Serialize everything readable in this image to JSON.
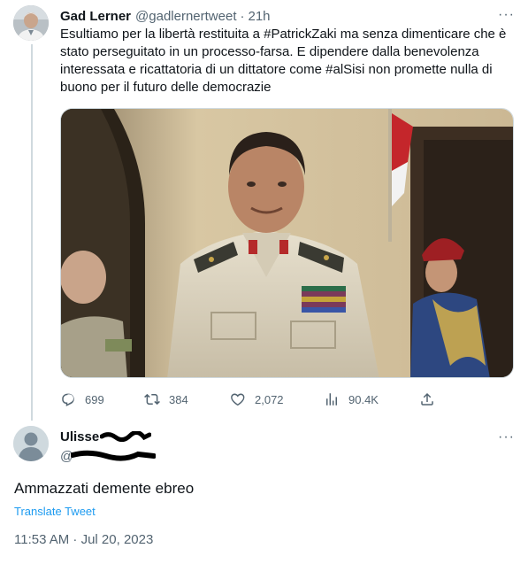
{
  "tweet1": {
    "author_name": "Gad Lerner",
    "handle": "@gadlernertweet",
    "separator": "·",
    "time": "21h",
    "more": "···",
    "text_parts": [
      "Esultiamo per la libertà restituita a ",
      "#PatrickZaki",
      " ma senza dimenticare che è stato perseguitato in un processo-farsa. E dipendere dalla benevolenza interessata e ricattatoria di un dittatore come ",
      "#alSisi",
      " non promette nulla di buono per il futuro delle democrazie"
    ],
    "hashtag_color": "#1d9bf0",
    "actions": {
      "reply_count": "699",
      "retweet_count": "384",
      "like_count": "2,072",
      "views_count": "90.4K"
    },
    "icons": [
      "reply-icon",
      "retweet-icon",
      "like-icon",
      "views-icon",
      "share-icon",
      "more-icon"
    ]
  },
  "tweet2": {
    "author_name": "Ulisse",
    "handle": "@",
    "more": "···",
    "text": "Ammazzati demente ebreo",
    "translate_label": "Translate Tweet",
    "timestamp": "11:53 AM · Jul 20, 2023"
  },
  "colors": {
    "text_primary": "#0f1419",
    "text_secondary": "#536471",
    "accent": "#1d9bf0",
    "border": "#cfd9de"
  }
}
